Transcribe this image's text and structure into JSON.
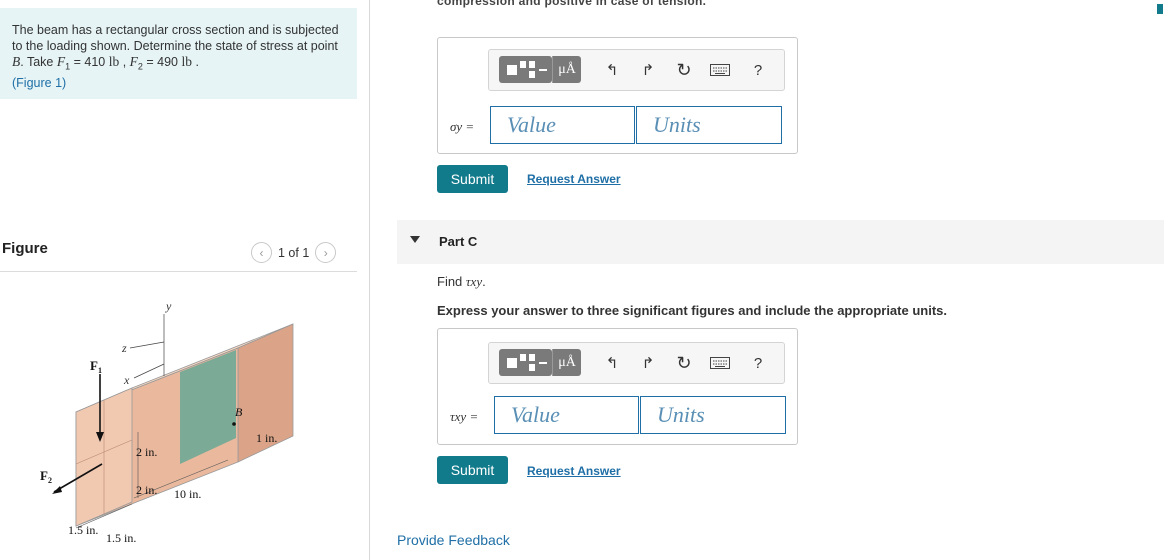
{
  "problem": {
    "text_1": "The beam has a rectangular cross section and is subjected to the loading shown. Determine the state of stress at point ",
    "point": "B",
    "text_2": ". Take ",
    "f1_sym": "F",
    "f1_sub": "1",
    "f1_eq": " = 410 ",
    "f1_unit": "lb",
    "sep": " , ",
    "f2_sym": "F",
    "f2_sub": "2",
    "f2_eq": " = 490 ",
    "f2_unit": "lb",
    "end": " .",
    "figure_link": "(Figure 1)"
  },
  "figure_panel": {
    "title": "Figure",
    "pager": "1 of 1",
    "prev_icon": "chevron-left-icon",
    "next_icon": "chevron-right-icon",
    "labels": {
      "y": "y",
      "z": "z",
      "x": "x",
      "F1": "F",
      "F1_sub": "1",
      "F2": "F",
      "F2_sub": "2",
      "B": "B",
      "one_in": "1 in.",
      "two_in_a": "2 in.",
      "two_in_b": "2 in.",
      "ten_in": "10 in.",
      "one5_a": "1.5 in.",
      "one5_b": "1.5 in."
    }
  },
  "partB": {
    "cut_text": "compression and positive in case of tension.",
    "toolbar": {
      "mu_label": "μÅ",
      "undo_icon": "undo-icon",
      "redo_icon": "redo-icon",
      "reset_icon": "reset-icon",
      "keyboard_icon": "keyboard-icon",
      "help_label": "?"
    },
    "symbol": "σy =",
    "value_placeholder": "Value",
    "units_placeholder": "Units",
    "submit": "Submit",
    "request": "Request Answer"
  },
  "partC": {
    "label": "Part C",
    "find_prefix": "Find ",
    "find_sym": "τxy",
    "find_suffix": ".",
    "express": "Express your answer to three significant figures and include the appropriate units.",
    "toolbar": {
      "mu_label": "μÅ",
      "undo_icon": "undo-icon",
      "redo_icon": "redo-icon",
      "reset_icon": "reset-icon",
      "keyboard_icon": "keyboard-icon",
      "help_label": "?"
    },
    "symbol": "τxy =",
    "value_placeholder": "Value",
    "units_placeholder": "Units",
    "submit": "Submit",
    "request": "Request Answer"
  },
  "feedback": "Provide Feedback",
  "colors": {
    "accent": "#117a8b",
    "link": "#1f6fa6",
    "problem_bg": "#e6f4f6"
  }
}
